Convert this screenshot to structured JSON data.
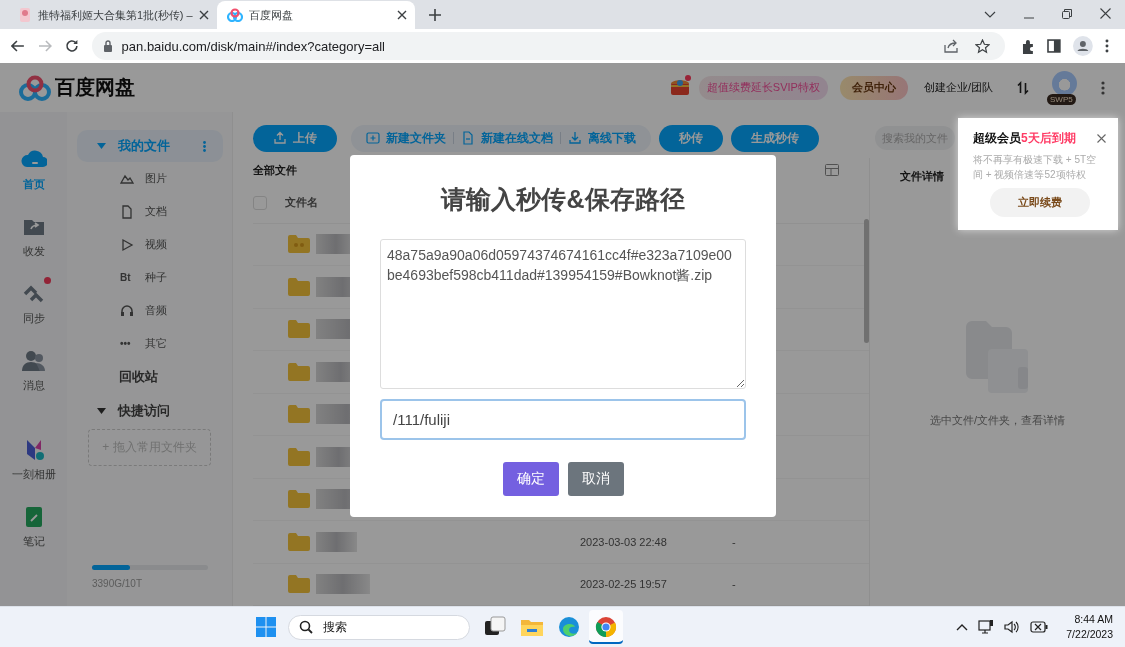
{
  "browser": {
    "tabs": [
      {
        "title": "推特福利姬大合集第1批(秒传) –",
        "selected": false
      },
      {
        "title": "百度网盘",
        "selected": true
      }
    ],
    "url": "pan.baidu.com/disk/main#/index?category=all"
  },
  "header": {
    "logo": "百度网盘",
    "promo": "超值续费延长SVIP特权",
    "member_center": "会员中心",
    "create_team": "创建企业/团队",
    "avatar_badge": "SWP5"
  },
  "rail": [
    {
      "label": "首页",
      "kind": "home",
      "selected": true,
      "badge": false
    },
    {
      "label": "收发",
      "kind": "share",
      "selected": false,
      "badge": false
    },
    {
      "label": "同步",
      "kind": "sync",
      "selected": false,
      "badge": true
    },
    {
      "label": "消息",
      "kind": "message",
      "selected": false,
      "badge": false
    },
    {
      "label": "一刻相册",
      "kind": "album",
      "selected": false,
      "badge": false
    },
    {
      "label": "笔记",
      "kind": "note",
      "selected": false,
      "badge": false
    }
  ],
  "sidebar": {
    "my_files": {
      "label": "我的文件",
      "expanded": true,
      "selected": true
    },
    "categories": [
      {
        "label": "图片",
        "kind": "image"
      },
      {
        "label": "文档",
        "kind": "doc"
      },
      {
        "label": "视频",
        "kind": "video"
      },
      {
        "label": "种子",
        "kind": "bt",
        "icon_text": "Bt"
      },
      {
        "label": "音频",
        "kind": "audio"
      },
      {
        "label": "其它",
        "kind": "other",
        "icon_text": "•••"
      }
    ],
    "recycle": "回收站",
    "quick_access": {
      "label": "快捷访问",
      "expanded": true
    },
    "drop_hint": "+ 拖入常用文件夹",
    "storage": {
      "level": 0.33,
      "text": "3390G/10T"
    }
  },
  "toolbar": {
    "buttons": [
      {
        "label": "上传",
        "kind": "primary"
      },
      {
        "label": "新建文件夹",
        "kind": "group"
      },
      {
        "label": "新建在线文档",
        "kind": "group"
      },
      {
        "label": "离线下载",
        "kind": "group"
      },
      {
        "label": "秒传",
        "kind": "primary"
      },
      {
        "label": "生成秒传",
        "kind": "primary"
      }
    ],
    "search": {
      "placeholder": "搜索我的文件"
    }
  },
  "files": {
    "breadcrumb": "全部文件",
    "column": "文件名",
    "select_all": {
      "checked": false
    },
    "rows": [
      {
        "kind": "shared"
      },
      {
        "kind": "folder"
      },
      {
        "kind": "folder"
      },
      {
        "kind": "folder"
      },
      {
        "kind": "folder"
      },
      {
        "kind": "folder"
      },
      {
        "kind": "folder"
      },
      {
        "kind": "folder",
        "date": "2023-03-03 22:48",
        "size": "-"
      },
      {
        "kind": "folder",
        "date": "2023-02-25 19:57",
        "size": "-"
      }
    ]
  },
  "details": {
    "title": "文件详情",
    "empty_hint": "选中文件/文件夹，查看详情"
  },
  "modal": {
    "title": "请输入秒传&保存路径",
    "code": "48a75a9a90a06d05974374674161cc4f#e323a7109e00be4693bef598cb411dad#139954159#Bowknot酱.zip",
    "path": "/111/fuliji",
    "buttons": [
      {
        "label": "确定",
        "kind": "confirm"
      },
      {
        "label": "取消",
        "kind": "cancel"
      }
    ]
  },
  "popover": {
    "title": "超级会员",
    "title_highlight": "5天后到期",
    "body": "将不再享有极速下载 + 5T空间 + 视频倍速等52项特权",
    "button": "立即续费"
  },
  "taskbar": {
    "search": "搜索",
    "time": "8:44 AM",
    "date": "7/22/2023",
    "apps": [
      {
        "kind": "taskview",
        "selected": false
      },
      {
        "kind": "explorer",
        "selected": false
      },
      {
        "kind": "edge",
        "selected": false
      },
      {
        "kind": "chrome",
        "selected": true
      }
    ]
  }
}
